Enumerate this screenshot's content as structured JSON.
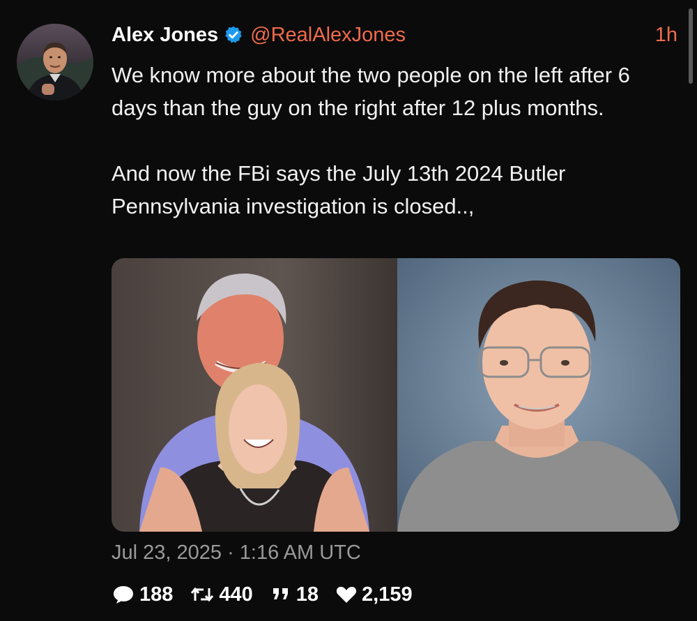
{
  "author": {
    "display_name": "Alex Jones",
    "handle": "@RealAlexJones",
    "verified": true,
    "time_ago": "1h"
  },
  "tweet": {
    "paragraph_1": "We know more about the two people on the left after 6 days than the guy on the right after 12 plus months.",
    "paragraph_2": "And now the FBi says the July 13th 2024 Butler Pennsylvania investigation is closed..,",
    "timestamp": "Jul 23, 2025 · 1:16 AM UTC"
  },
  "stats": {
    "replies": "188",
    "retweets": "440",
    "quotes": "18",
    "likes": "2,159"
  },
  "icons": {
    "verified": "verified-badge-icon",
    "reply": "speech-bubble-icon",
    "retweet": "retweet-arrows-icon",
    "quote": "quote-marks-icon",
    "like": "heart-icon"
  },
  "colors": {
    "background": "#0b0b0b",
    "accent": "#f06a4d",
    "verified": "#1d9bf0",
    "muted": "#9a9a9a"
  }
}
